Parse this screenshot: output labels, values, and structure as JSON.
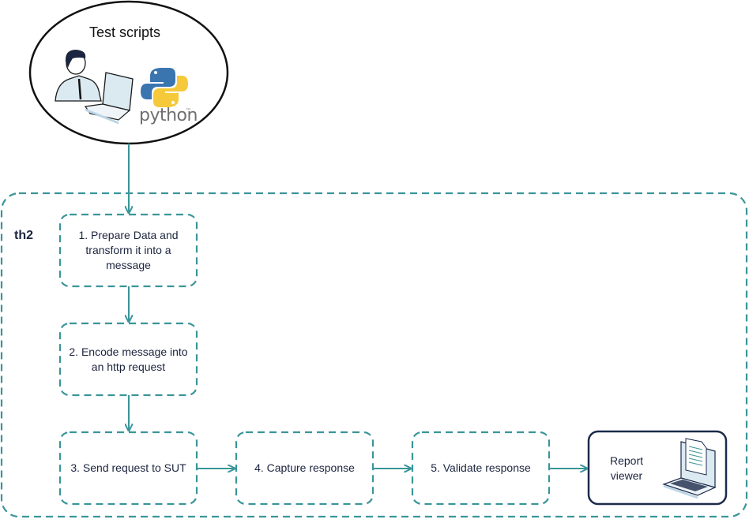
{
  "diagram": {
    "source_node": {
      "title": "Test scripts",
      "icons": [
        "person-at-laptop-icon",
        "python-logo-icon"
      ],
      "python_wordmark": "python",
      "trademark": "™"
    },
    "container": {
      "label": "th2"
    },
    "steps": [
      {
        "id": 1,
        "label": "1. Prepare Data and transform it into a message"
      },
      {
        "id": 2,
        "label": "2. Encode message into an http request"
      },
      {
        "id": 3,
        "label": "3. Send request to SUT"
      },
      {
        "id": 4,
        "label": "4. Capture response"
      },
      {
        "id": 5,
        "label": "5. Validate response"
      }
    ],
    "output_node": {
      "label": "Report viewer",
      "icon": "laptop-with-report-icon"
    },
    "edges": [
      {
        "from": "Test scripts",
        "to": "1"
      },
      {
        "from": "1",
        "to": "2"
      },
      {
        "from": "2",
        "to": "3"
      },
      {
        "from": "3",
        "to": "4"
      },
      {
        "from": "4",
        "to": "5"
      },
      {
        "from": "5",
        "to": "Report viewer"
      }
    ],
    "colors": {
      "accent": "#3a9599",
      "dark": "#1b2a4a",
      "text": "#1c2540"
    }
  }
}
